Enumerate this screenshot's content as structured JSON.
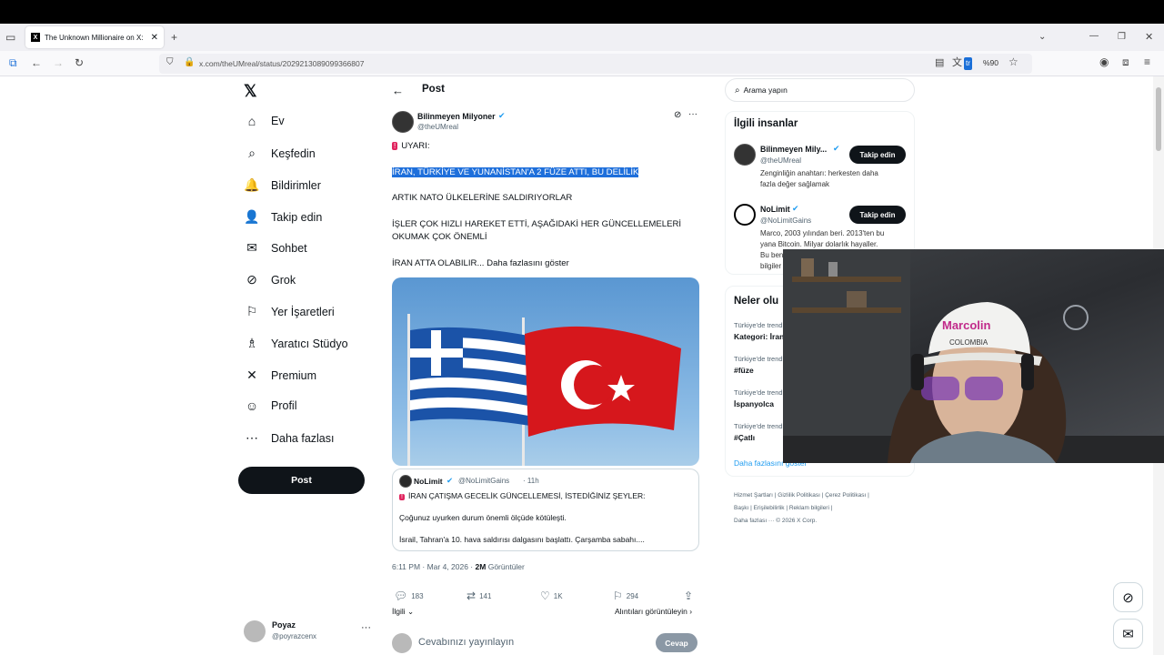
{
  "browser": {
    "tab_title": "The Unknown Millionaire on X:",
    "tab_favicon": "X",
    "url": "x.com/theUMreal/status/2029213089099366807",
    "zoom": "%90"
  },
  "sidebar": {
    "items": [
      {
        "label": "Ev",
        "icon": "home-icon",
        "glyph": "⌂"
      },
      {
        "label": "Keşfedin",
        "icon": "search-icon",
        "glyph": "⌕"
      },
      {
        "label": "Bildirimler",
        "icon": "bell-icon",
        "glyph": "🔔"
      },
      {
        "label": "Takip edin",
        "icon": "add-person-icon",
        "glyph": "👤"
      },
      {
        "label": "Sohbet",
        "icon": "mail-icon",
        "glyph": "✉"
      },
      {
        "label": "Grok",
        "icon": "grok-icon",
        "glyph": "⊘"
      },
      {
        "label": "Yer İşaretleri",
        "icon": "bookmark-icon",
        "glyph": "⚐"
      },
      {
        "label": "Yaratıcı Stüdyo",
        "icon": "creator-studio-icon",
        "glyph": "♗"
      },
      {
        "label": "Premium",
        "icon": "x-premium-icon",
        "glyph": "✕"
      },
      {
        "label": "Profil",
        "icon": "profile-icon",
        "glyph": "☺"
      },
      {
        "label": "Daha fazlası",
        "icon": "more-circle-icon",
        "glyph": "⋯"
      }
    ],
    "post_button": "Post",
    "account": {
      "name": "Poyaz",
      "handle": "@poyrazcenx"
    }
  },
  "main": {
    "header_title": "Post",
    "author": {
      "name": "Bilinmeyen Milyoner",
      "handle": "@theUMreal"
    },
    "text": {
      "line1": "UYARI:",
      "line2": "İRAN, TÜRKİYE VE YUNANİSTAN'A 2 FÜZE ATTI, BU DELİLİK",
      "line3": "ARTIK NATO ÜLKELERİNE SALDIRIYORLAR",
      "line4": "İŞLER ÇOK HIZLI HAREKET ETTİ, AŞAĞIDAKİ HER GÜNCELLEMELERİ",
      "line5": "OKUMAK ÇOK ÖNEMLİ",
      "line6": "İRAN ATTA OLABILIR...",
      "show_more": "Daha fazlasını göster"
    },
    "quote": {
      "name": "NoLimit",
      "handle": "@NoLimitGains",
      "time": "· 11h",
      "line1": "İRAN ÇATIŞMA GECELİK GÜNCELLEMESİ, İSTEDİĞİNİZ ŞEYLER:",
      "line2": "Çoğunuz uyurken durum önemli ölçüde kötüleşti.",
      "line3": "İsrail, Tahran'a 10. hava saldırısı dalgasını başlattı. Çarşamba sabahı...."
    },
    "meta": {
      "time": "6:11 PM · Mar 4, 2026 ·",
      "views": "2M",
      "views_label": "Görüntüler"
    },
    "actions": {
      "replies": "183",
      "reposts": "141",
      "likes": "1K",
      "bookmarks": "294"
    },
    "relevant": "İlgili",
    "quotes_link": "Alıntıları görüntüleyin",
    "reply_placeholder": "Cevabınızı yayınlayın",
    "reply_button": "Cevap"
  },
  "right": {
    "search_placeholder": "Arama yapın",
    "people_title": "İlgili insanlar",
    "people": [
      {
        "name": "Bilinmeyen Mily...",
        "handle": "@theUMreal",
        "bio1": "Zenginliğin anahtarı: herkesten daha",
        "bio2": "fazla değer sağlamak",
        "button": "Takip edin"
      },
      {
        "name": "NoLimit",
        "handle": "@NoLimitGains",
        "bio1": "Marco, 2003 yılından beri. 2013'ten bu",
        "bio2": "yana Bitcoin. Milyar dolarlık hayaller.",
        "bio3": "Bu ben",
        "bio4": "bilgiler",
        "button": "Takip edin"
      }
    ],
    "trends_title": "Neler olu",
    "trends": [
      {
        "cat": "Türkiye'de trend",
        "title": "Kategori: İran"
      },
      {
        "cat": "Türkiye'de trend",
        "title": "#füze"
      },
      {
        "cat": "Türkiye'de trend",
        "title": "İspanyolca"
      },
      {
        "cat": "Türkiye'de trend",
        "title": "#Çatlı"
      }
    ],
    "show_more": "Daha fazlasını göster",
    "footer": {
      "l1": "Hizmet Şartları",
      "l2": "Gizlilik Politikası",
      "l3": "Çerez Politikası",
      "l4": "Başkı",
      "l5": "Erişilebilirlik",
      "l6": "Reklam bilgileri",
      "l7": "Daha fazlası ···",
      "copy": "© 2026 X Corp."
    }
  },
  "webcam": {
    "cap_text": "COLOMBIA",
    "cap_brand": "Marcolin"
  }
}
